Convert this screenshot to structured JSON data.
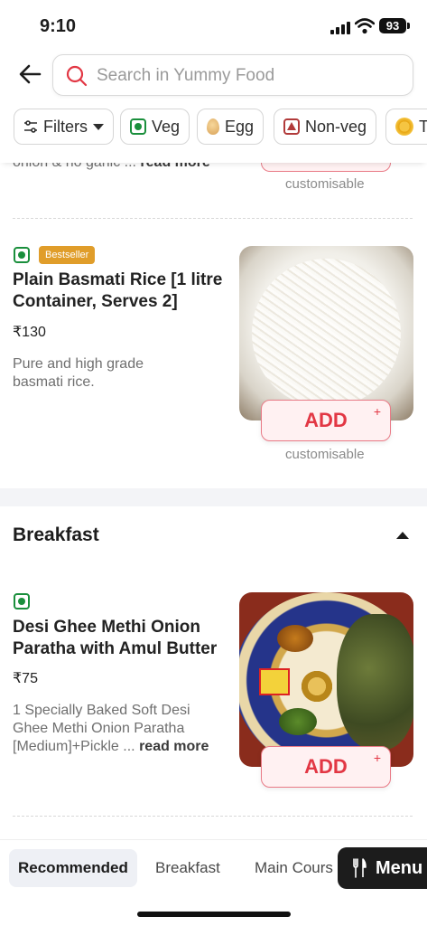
{
  "status_bar": {
    "time": "9:10",
    "battery": "93"
  },
  "header": {
    "search_placeholder": "Search in Yummy Food"
  },
  "filters": [
    {
      "label": "Filters"
    },
    {
      "label": "Veg"
    },
    {
      "label": "Egg"
    },
    {
      "label": "Non-veg"
    },
    {
      "label": "To"
    }
  ],
  "items": [
    {
      "desc_tail": "onion & no garlic ...",
      "read_more": "read more",
      "customisable": "customisable"
    },
    {
      "badge": "Bestseller",
      "title": "Plain Basmati Rice [1 litre Container, Serves 2]",
      "price": "₹130",
      "desc": "Pure and high grade basmati rice.",
      "add_label": "ADD",
      "plus": "+",
      "customisable": "customisable"
    },
    {
      "title": "Desi Ghee Methi Onion Paratha with Amul Butter",
      "price": "₹75",
      "desc": "1 Specially Baked Soft Desi Ghee Methi Onion Paratha [Medium]+Pickle ...",
      "read_more": "read more",
      "add_label": "ADD",
      "plus": "+"
    }
  ],
  "section": {
    "title": "Breakfast"
  },
  "bottom_nav": {
    "tabs": [
      "Recommended",
      "Breakfast",
      "Main Cours"
    ],
    "menu_label": "Menu"
  },
  "colors": {
    "accent": "#e23744",
    "veg": "#1a8f3c",
    "nonveg": "#b13a3a",
    "bestseller": "#e09d2a"
  }
}
